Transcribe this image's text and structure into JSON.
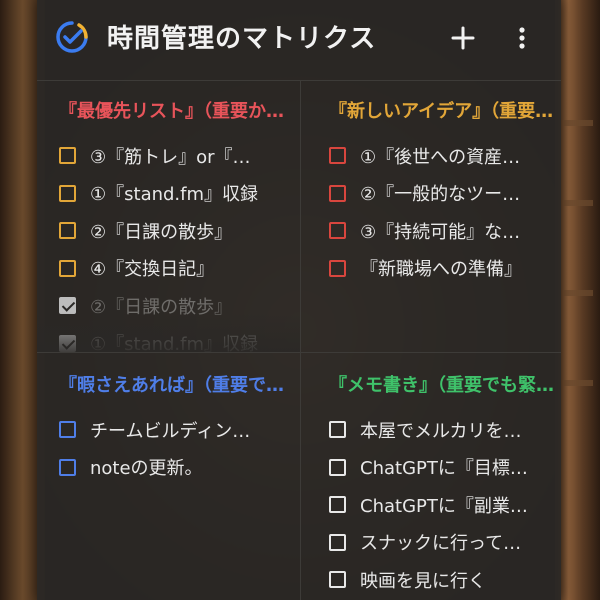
{
  "app": {
    "title": "時間管理のマトリクス",
    "add_label": "+",
    "menu_label": "⋮"
  },
  "colors": {
    "q1_accent": "#e8545a",
    "q1_checkbox": "#e2a638",
    "q2_accent": "#e2a638",
    "q2_checkbox": "#d9463e",
    "q3_accent": "#4f7ee8",
    "q3_checkbox": "#4f7ee8",
    "q4_accent": "#3fc26a",
    "q4_checkbox": "#e8e8e8",
    "logo_blue": "#3b7cf0",
    "logo_yellow": "#f2b233"
  },
  "quadrants": [
    {
      "title": "『最優先リスト』（重要かつ緊急）",
      "items": [
        {
          "text": "③『筋トレ』or『…",
          "done": false
        },
        {
          "text": "①『stand.fm』収録",
          "done": false
        },
        {
          "text": "②『日課の散歩』",
          "done": false
        },
        {
          "text": "④『交換日記』",
          "done": false
        },
        {
          "text": "②『日課の散歩』",
          "done": true
        },
        {
          "text": "①『stand.fm』収録",
          "done": true
        }
      ]
    },
    {
      "title": "『新しいアイデア』（重要だが緊急でない）",
      "items": [
        {
          "text": "①『後世への資産…",
          "done": false
        },
        {
          "text": "②『一般的なツー…",
          "done": false
        },
        {
          "text": "③『持続可能』な…",
          "done": false
        },
        {
          "text": "『新職場への準備』",
          "done": false
        }
      ]
    },
    {
      "title": "『暇さえあれば』（重要でない）",
      "items": [
        {
          "text": "チームビルディン…",
          "done": false
        },
        {
          "text": "noteの更新。",
          "done": false
        }
      ]
    },
    {
      "title": "『メモ書き』（重要でも緊急でもない）",
      "items": [
        {
          "text": "本屋でメルカリを…",
          "done": false
        },
        {
          "text": "ChatGPTに『目標…",
          "done": false
        },
        {
          "text": "ChatGPTに『副業…",
          "done": false
        },
        {
          "text": "スナックに行って…",
          "done": false
        },
        {
          "text": "映画を見に行く",
          "done": false
        }
      ]
    }
  ]
}
